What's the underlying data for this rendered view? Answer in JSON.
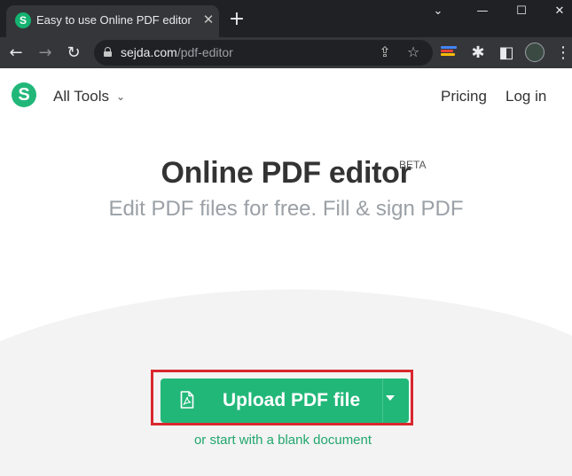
{
  "browser": {
    "tab_title": "Easy to use Online PDF editor",
    "tab_favicon_letter": "S",
    "url_host": "sejda.com",
    "url_path": "/pdf-editor",
    "icons": {
      "tab_close": "close-icon",
      "new_tab": "plus-icon",
      "minimize": "minimize-icon",
      "maximize": "maximize-icon",
      "window_close": "close-icon",
      "back": "arrow-left-icon",
      "forward": "arrow-right-icon",
      "reload": "reload-icon",
      "lock": "lock-icon",
      "share": "share-icon",
      "bookmark": "star-icon",
      "extension_colors": "color-extension-icon",
      "extensions": "puzzle-icon",
      "sidepanel": "sidepanel-icon",
      "profile": "avatar",
      "menu": "kebab-menu-icon"
    },
    "colors": {
      "tabstrip": "#202124",
      "toolbar": "#35363a"
    }
  },
  "site": {
    "logo_letter": "S",
    "nav": {
      "all_tools": "All Tools",
      "pricing": "Pricing",
      "login": "Log in"
    },
    "title": "Online PDF editor",
    "beta": "BETA",
    "subtitle": "Edit PDF files for free. Fill & sign PDF",
    "upload_button": "Upload PDF file",
    "blank_link": "or start with a blank document",
    "colors": {
      "brand": "#21b779",
      "highlight_box": "#d9272e",
      "link": "#21a66c"
    }
  }
}
